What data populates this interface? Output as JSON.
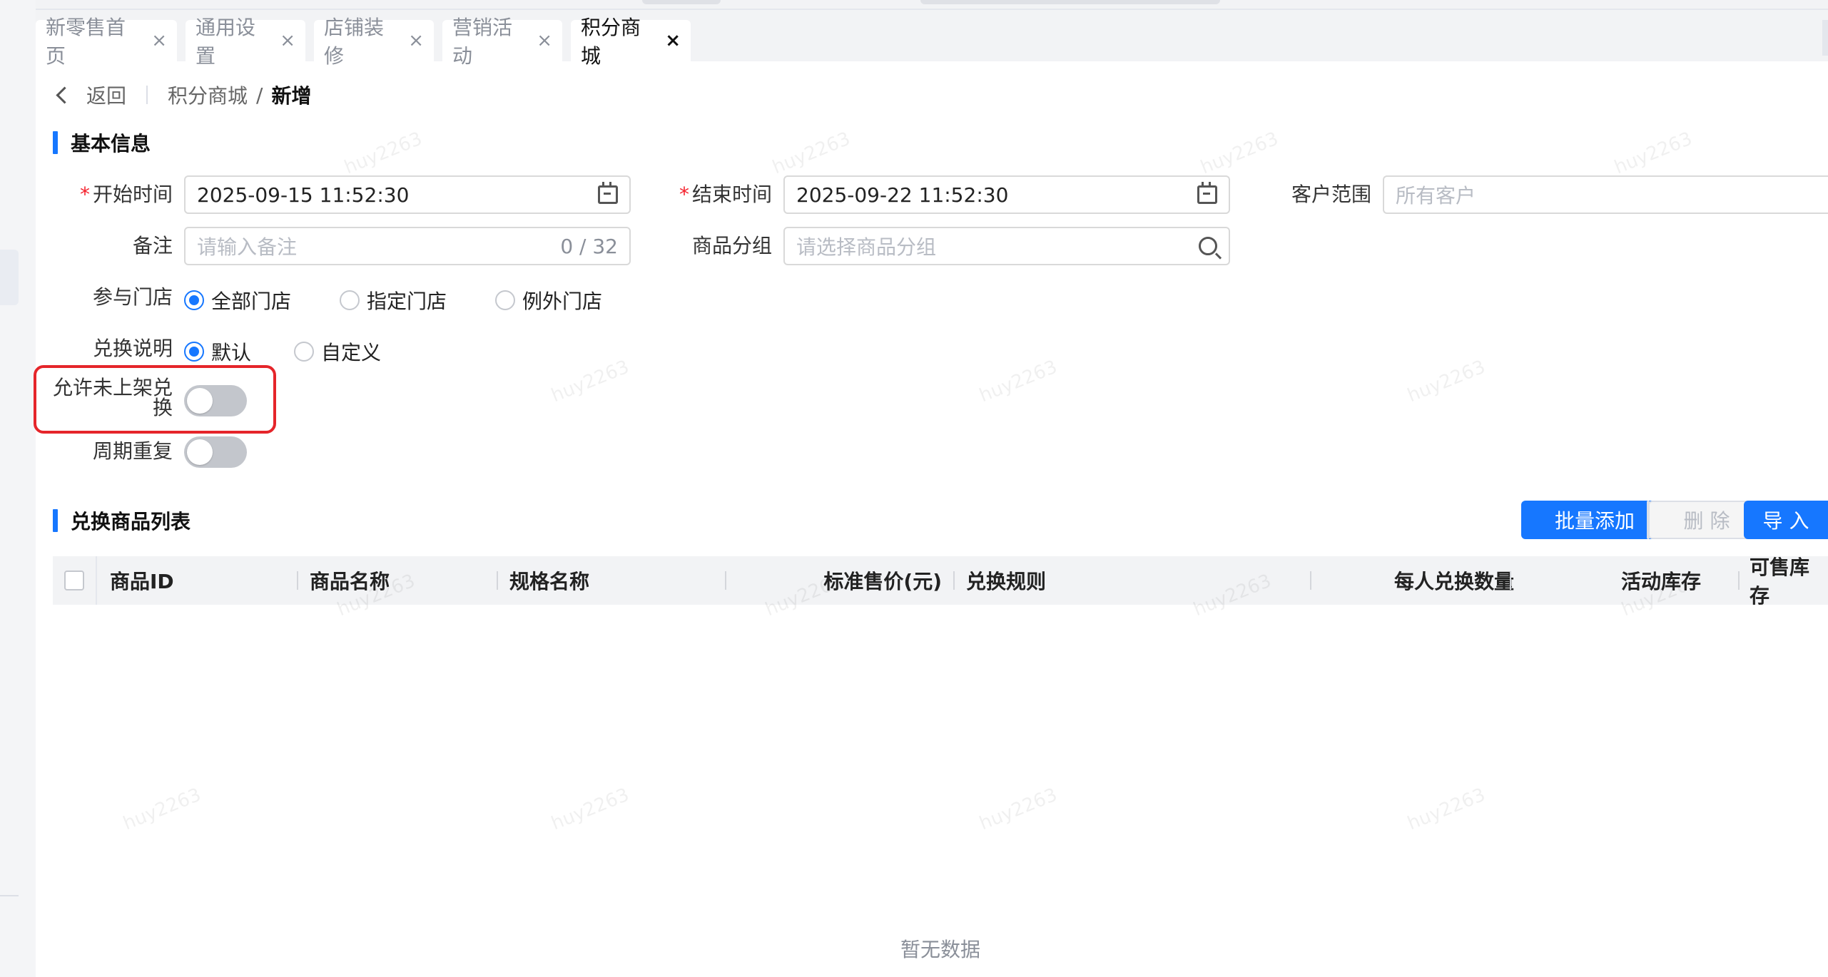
{
  "tabs": [
    {
      "label": "新零售首页",
      "close": "×"
    },
    {
      "label": "通用设置",
      "close": "×"
    },
    {
      "label": "店铺装修",
      "close": "×"
    },
    {
      "label": "营销活动",
      "close": "×"
    },
    {
      "label": "积分商城",
      "close": "×",
      "active": true
    }
  ],
  "breadcrumb": {
    "back": "返回",
    "parent": "积分商城",
    "separator": "/",
    "current": "新增"
  },
  "basic_info": {
    "title": "基本信息",
    "start_time": {
      "required": "*",
      "label": "开始时间",
      "value": "2025-09-15 11:52:30",
      "icon": "calendar-icon"
    },
    "end_time": {
      "required": "*",
      "label": "结束时间",
      "value": "2025-09-22 11:52:30",
      "icon": "calendar-icon"
    },
    "customer_scope": {
      "label": "客户范围",
      "placeholder": "所有客户"
    },
    "remark": {
      "label": "备注",
      "placeholder": "请输入备注",
      "counter": "0 / 32"
    },
    "product_group": {
      "label": "商品分组",
      "placeholder": "请选择商品分组",
      "icon": "search-icon"
    },
    "stores": {
      "label": "参与门店",
      "options": [
        "全部门店",
        "指定门店",
        "例外门店"
      ],
      "selected": "全部门店"
    },
    "exchange_desc": {
      "label": "兑换说明",
      "options": [
        "默认",
        "自定义"
      ],
      "selected": "默认"
    },
    "allow_unlisted": {
      "label_line1": "允许未上架兑",
      "label_line2": "换",
      "enabled": false
    },
    "periodic_repeat": {
      "label": "周期重复",
      "enabled": false
    }
  },
  "product_list": {
    "title": "兑换商品列表",
    "buttons": {
      "batch_add": "批量添加",
      "delete": "删 除",
      "import": "导 入"
    },
    "columns": [
      "商品ID",
      "商品名称",
      "规格名称",
      "标准售价(元)",
      "兑换规则",
      "每人兑换数量",
      "活动库存",
      "可售库存"
    ],
    "empty_text": "暂无数据"
  },
  "watermark": "huy2263",
  "colors": {
    "primary": "#1677ff",
    "required": "#f5222d",
    "highlight_border": "#e5252a"
  }
}
